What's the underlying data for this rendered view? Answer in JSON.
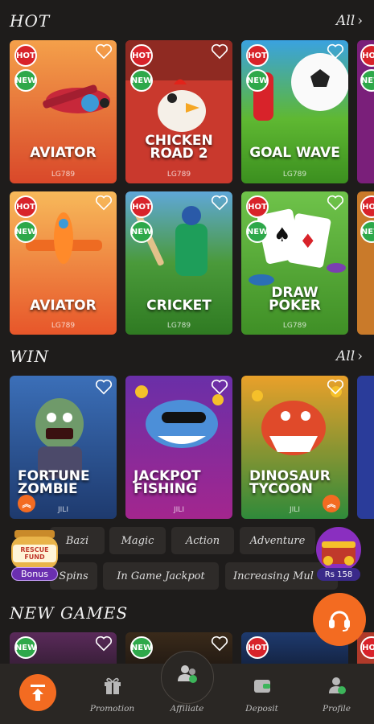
{
  "sections": {
    "hot": {
      "title": "HOT",
      "all_label": "All",
      "all_chevron": "›"
    },
    "win": {
      "title": "WIN",
      "all_label": "All",
      "all_chevron": "›"
    },
    "new_games": {
      "title": "NEW GAMES"
    }
  },
  "badges": {
    "hot": "HOT",
    "new": "NEW"
  },
  "hot_cards": [
    {
      "title_l1": "AVIATOR",
      "title_l2": "",
      "provider": "LG789",
      "hot": true,
      "new": true
    },
    {
      "title_l1": "CHICKEN",
      "title_l2": "ROAD 2",
      "provider": "LG789",
      "hot": true,
      "new": true
    },
    {
      "title_l1": "GOAL WAVE",
      "title_l2": "",
      "provider": "LG789",
      "hot": true,
      "new": true
    },
    {
      "title_l1": "AVIATOR",
      "title_l2": "",
      "provider": "LG789",
      "hot": true,
      "new": true
    },
    {
      "title_l1": "CRICKET",
      "title_l2": "",
      "provider": "LG789",
      "hot": true,
      "new": true
    },
    {
      "title_l1": "DRAW",
      "title_l2": "POKER",
      "provider": "LG789",
      "hot": true,
      "new": true
    }
  ],
  "win_cards": [
    {
      "title_l1": "FORTUNE",
      "title_l2": "ZOMBIE",
      "provider": "JILI"
    },
    {
      "title_l1": "JACKPOT",
      "title_l2": "FISHING",
      "provider": "JILI"
    },
    {
      "title_l1": "DINOSAUR",
      "title_l2": "TYCOON",
      "provider": "JILI"
    }
  ],
  "category_chips_row1": [
    "Bazi",
    "Magic",
    "Action",
    "Adventure"
  ],
  "category_chips_row2": [
    "Spins",
    "In Game Jackpot",
    "Increasing Mul"
  ],
  "rescue_fund": {
    "line1": "RESCUE",
    "line2": "FUND",
    "button": "Bonus"
  },
  "wallet_badge": {
    "amount": "Rs 158"
  },
  "bottom_nav": {
    "promotion": "Promotion",
    "affiliate": "Affiliate",
    "deposit": "Deposit",
    "profile": "Profile"
  },
  "colors": {
    "accent": "#f36b21",
    "hot_badge": "#d8232a",
    "new_badge": "#2ea84a",
    "background": "#1e1c1b"
  }
}
